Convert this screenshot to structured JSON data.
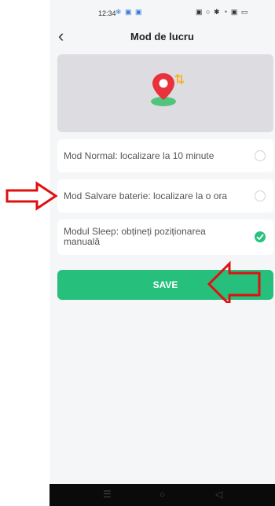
{
  "status_bar": {
    "time": "12:34",
    "left_icons": "❄ ▣ ▣",
    "right_icons": "▣ ○ ✱ ◔ ▣ ▭"
  },
  "nav": {
    "back_icon": "‹",
    "title": "Mod de lucru"
  },
  "hero": {
    "icon": "location-pin-icon",
    "colors": {
      "pin": "#e8323c",
      "ground": "#52c47c",
      "arrows": "#f2b53a",
      "background": "#dddde1"
    }
  },
  "options": [
    {
      "label": "Mod Normal: localizare la 10 minute",
      "selected": false
    },
    {
      "label": "Mod Salvare baterie: localizare la o ora",
      "selected": false
    },
    {
      "label_line1": "Modul Sleep: obțineți poziționarea",
      "label_line2": "manuală",
      "selected": true
    }
  ],
  "save_button": {
    "label": "SAVE",
    "color": "#26c07c"
  },
  "navigation_bar": {
    "icons": [
      "menu-icon",
      "home-icon",
      "back-icon"
    ],
    "glyphs": [
      "☰",
      "○",
      "◁"
    ]
  },
  "annotations": {
    "arrow_color": "#e01010"
  }
}
